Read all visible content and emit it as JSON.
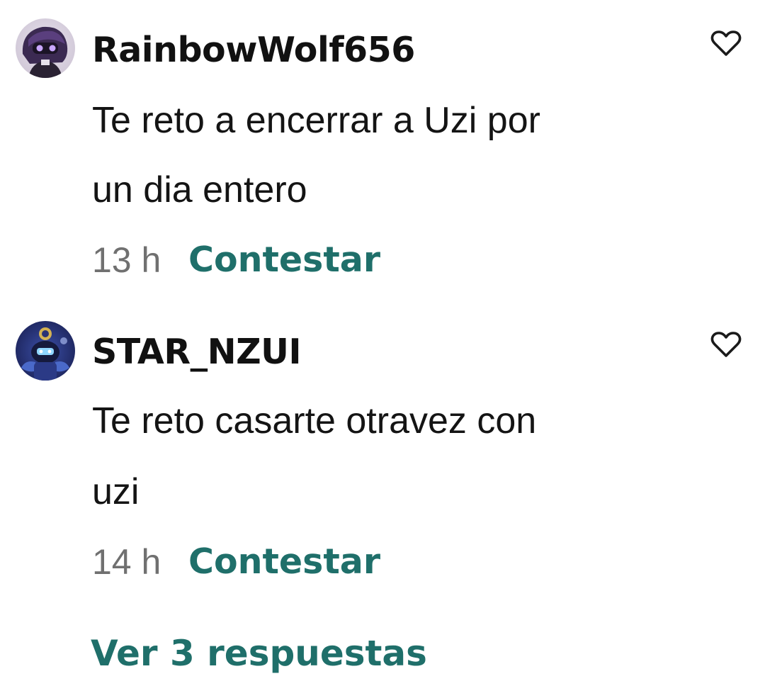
{
  "comments": [
    {
      "username": "RainbowWolf656",
      "avatar_icon": "purple-character-avatar",
      "text_lines": [
        "Te reto a encerrar a Uzi por",
        "un dia entero"
      ],
      "time": "13 h",
      "reply_label": "Contestar",
      "like_icon": "heart-outline-icon"
    },
    {
      "username": "STAR_NZUI",
      "avatar_icon": "blue-robot-avatar",
      "text_lines": [
        "Te reto casarte otravez con",
        "uzi"
      ],
      "time": "14 h",
      "reply_label": "Contestar",
      "like_icon": "heart-outline-icon"
    }
  ],
  "view_replies_label": "Ver 3 respuestas",
  "colors": {
    "accent": "#1f6f6a",
    "meta_gray": "#707070",
    "text": "#141414"
  }
}
